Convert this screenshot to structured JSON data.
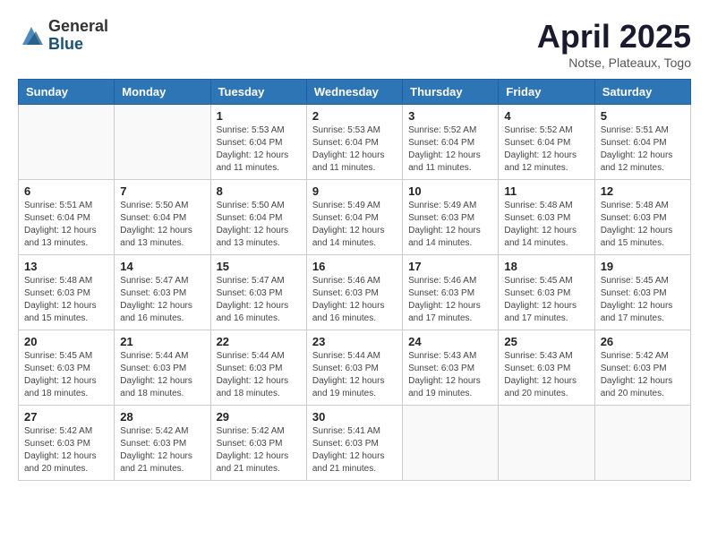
{
  "logo": {
    "general": "General",
    "blue": "Blue"
  },
  "title": "April 2025",
  "subtitle": "Notse, Plateaux, Togo",
  "days_of_week": [
    "Sunday",
    "Monday",
    "Tuesday",
    "Wednesday",
    "Thursday",
    "Friday",
    "Saturday"
  ],
  "weeks": [
    [
      {
        "day": "",
        "info": ""
      },
      {
        "day": "",
        "info": ""
      },
      {
        "day": "1",
        "info": "Sunrise: 5:53 AM\nSunset: 6:04 PM\nDaylight: 12 hours and 11 minutes."
      },
      {
        "day": "2",
        "info": "Sunrise: 5:53 AM\nSunset: 6:04 PM\nDaylight: 12 hours and 11 minutes."
      },
      {
        "day": "3",
        "info": "Sunrise: 5:52 AM\nSunset: 6:04 PM\nDaylight: 12 hours and 11 minutes."
      },
      {
        "day": "4",
        "info": "Sunrise: 5:52 AM\nSunset: 6:04 PM\nDaylight: 12 hours and 12 minutes."
      },
      {
        "day": "5",
        "info": "Sunrise: 5:51 AM\nSunset: 6:04 PM\nDaylight: 12 hours and 12 minutes."
      }
    ],
    [
      {
        "day": "6",
        "info": "Sunrise: 5:51 AM\nSunset: 6:04 PM\nDaylight: 12 hours and 13 minutes."
      },
      {
        "day": "7",
        "info": "Sunrise: 5:50 AM\nSunset: 6:04 PM\nDaylight: 12 hours and 13 minutes."
      },
      {
        "day": "8",
        "info": "Sunrise: 5:50 AM\nSunset: 6:04 PM\nDaylight: 12 hours and 13 minutes."
      },
      {
        "day": "9",
        "info": "Sunrise: 5:49 AM\nSunset: 6:04 PM\nDaylight: 12 hours and 14 minutes."
      },
      {
        "day": "10",
        "info": "Sunrise: 5:49 AM\nSunset: 6:03 PM\nDaylight: 12 hours and 14 minutes."
      },
      {
        "day": "11",
        "info": "Sunrise: 5:48 AM\nSunset: 6:03 PM\nDaylight: 12 hours and 14 minutes."
      },
      {
        "day": "12",
        "info": "Sunrise: 5:48 AM\nSunset: 6:03 PM\nDaylight: 12 hours and 15 minutes."
      }
    ],
    [
      {
        "day": "13",
        "info": "Sunrise: 5:48 AM\nSunset: 6:03 PM\nDaylight: 12 hours and 15 minutes."
      },
      {
        "day": "14",
        "info": "Sunrise: 5:47 AM\nSunset: 6:03 PM\nDaylight: 12 hours and 16 minutes."
      },
      {
        "day": "15",
        "info": "Sunrise: 5:47 AM\nSunset: 6:03 PM\nDaylight: 12 hours and 16 minutes."
      },
      {
        "day": "16",
        "info": "Sunrise: 5:46 AM\nSunset: 6:03 PM\nDaylight: 12 hours and 16 minutes."
      },
      {
        "day": "17",
        "info": "Sunrise: 5:46 AM\nSunset: 6:03 PM\nDaylight: 12 hours and 17 minutes."
      },
      {
        "day": "18",
        "info": "Sunrise: 5:45 AM\nSunset: 6:03 PM\nDaylight: 12 hours and 17 minutes."
      },
      {
        "day": "19",
        "info": "Sunrise: 5:45 AM\nSunset: 6:03 PM\nDaylight: 12 hours and 17 minutes."
      }
    ],
    [
      {
        "day": "20",
        "info": "Sunrise: 5:45 AM\nSunset: 6:03 PM\nDaylight: 12 hours and 18 minutes."
      },
      {
        "day": "21",
        "info": "Sunrise: 5:44 AM\nSunset: 6:03 PM\nDaylight: 12 hours and 18 minutes."
      },
      {
        "day": "22",
        "info": "Sunrise: 5:44 AM\nSunset: 6:03 PM\nDaylight: 12 hours and 18 minutes."
      },
      {
        "day": "23",
        "info": "Sunrise: 5:44 AM\nSunset: 6:03 PM\nDaylight: 12 hours and 19 minutes."
      },
      {
        "day": "24",
        "info": "Sunrise: 5:43 AM\nSunset: 6:03 PM\nDaylight: 12 hours and 19 minutes."
      },
      {
        "day": "25",
        "info": "Sunrise: 5:43 AM\nSunset: 6:03 PM\nDaylight: 12 hours and 20 minutes."
      },
      {
        "day": "26",
        "info": "Sunrise: 5:42 AM\nSunset: 6:03 PM\nDaylight: 12 hours and 20 minutes."
      }
    ],
    [
      {
        "day": "27",
        "info": "Sunrise: 5:42 AM\nSunset: 6:03 PM\nDaylight: 12 hours and 20 minutes."
      },
      {
        "day": "28",
        "info": "Sunrise: 5:42 AM\nSunset: 6:03 PM\nDaylight: 12 hours and 21 minutes."
      },
      {
        "day": "29",
        "info": "Sunrise: 5:42 AM\nSunset: 6:03 PM\nDaylight: 12 hours and 21 minutes."
      },
      {
        "day": "30",
        "info": "Sunrise: 5:41 AM\nSunset: 6:03 PM\nDaylight: 12 hours and 21 minutes."
      },
      {
        "day": "",
        "info": ""
      },
      {
        "day": "",
        "info": ""
      },
      {
        "day": "",
        "info": ""
      }
    ]
  ]
}
